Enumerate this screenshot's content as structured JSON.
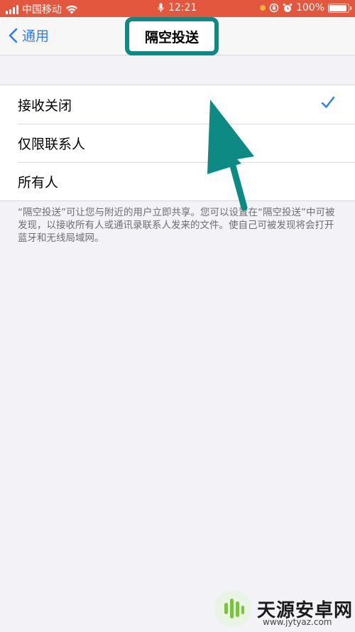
{
  "status_bar": {
    "carrier": "中国移动",
    "time": "12:21",
    "battery": "100%",
    "battery_level": 1.0,
    "bg_color": "#e4573f"
  },
  "nav": {
    "back_label": "通用",
    "title": "隔空投送",
    "highlight_color": "#0c8a83",
    "accent_color": "#2f7cf6"
  },
  "options": [
    {
      "label": "接收关闭",
      "selected": true
    },
    {
      "label": "仅限联系人",
      "selected": false
    },
    {
      "label": "所有人",
      "selected": false
    }
  ],
  "footer": "“隔空投送”可让您与附近的用户立即共享。您可以设置在“隔空投送”中可被发现，以接收所有人或通讯录联系人发来的文件。使自己可被发现将会打开蓝牙和无线局域网。",
  "watermark": {
    "name": "天源安卓网",
    "url": "www.jytyaz.com"
  },
  "icons": [
    "signal-icon",
    "wifi-icon",
    "mic-icon",
    "lock-rotation-icon",
    "alarm-icon",
    "battery-icon",
    "chevron-left-icon",
    "checkmark-icon",
    "annotation-arrow"
  ]
}
